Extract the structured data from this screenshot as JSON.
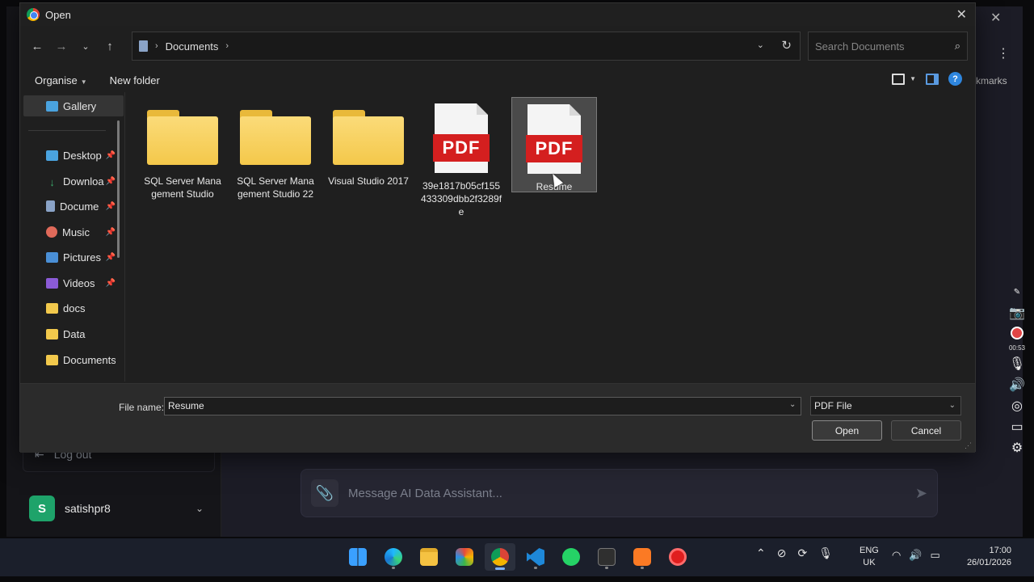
{
  "dialog": {
    "title": "Open",
    "breadcrumb": [
      "Documents"
    ],
    "search_placeholder": "Search Documents",
    "commands": {
      "organise": "Organise",
      "new_folder": "New folder"
    },
    "nav_items": [
      {
        "label": "Gallery",
        "icon": "gallery-icon",
        "pinned": false
      },
      {
        "label": "Desktop",
        "icon": "desktop-icon",
        "pinned": true
      },
      {
        "label": "Downloa",
        "icon": "downloads-icon",
        "pinned": true
      },
      {
        "label": "Docume",
        "icon": "documents-icon",
        "pinned": true
      },
      {
        "label": "Music",
        "icon": "music-icon",
        "pinned": true
      },
      {
        "label": "Pictures",
        "icon": "pictures-icon",
        "pinned": true
      },
      {
        "label": "Videos",
        "icon": "videos-icon",
        "pinned": true
      },
      {
        "label": "docs",
        "icon": "folder-icon",
        "pinned": false
      },
      {
        "label": "Data",
        "icon": "folder-icon",
        "pinned": false
      },
      {
        "label": "Documents",
        "icon": "folder-icon",
        "pinned": false
      }
    ],
    "files": [
      {
        "name": "SQL Server Management Studio",
        "type": "folder"
      },
      {
        "name": "SQL Server Management Studio 22",
        "type": "folder"
      },
      {
        "name": "Visual Studio 2017",
        "type": "folder"
      },
      {
        "name": "39e1817b05cf155433309dbb2f3289fe",
        "type": "pdf",
        "badge": "PDF"
      },
      {
        "name": "Resume",
        "type": "pdf",
        "badge": "PDF",
        "selected": true
      }
    ],
    "file_name_label": "File name:",
    "file_name_value": "Resume",
    "file_type": "PDF File",
    "open_label": "Open",
    "cancel_label": "Cancel"
  },
  "background": {
    "logout_label": "Log out",
    "user_initial": "S",
    "username": "satishpr8",
    "message_placeholder": "Message AI Data Assistant...",
    "bookmarks_text": "kmarks",
    "recording_time": "00:53"
  },
  "taskbar": {
    "apps": [
      "windows-start",
      "edge",
      "file-explorer",
      "photos",
      "chrome",
      "vscode",
      "whatsapp",
      "terminal",
      "xampp",
      "screen-recorder"
    ],
    "active_app": "chrome",
    "lang_line1": "ENG",
    "lang_line2": "UK",
    "time": "17:00",
    "date": "26/01/2026"
  }
}
